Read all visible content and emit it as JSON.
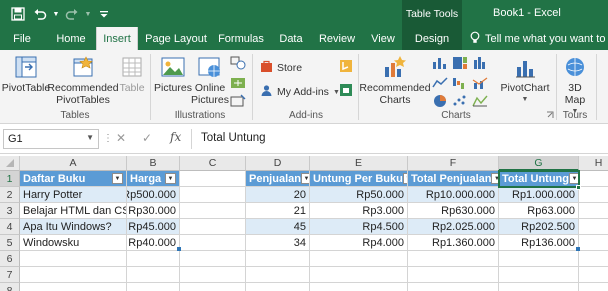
{
  "titlebar": {
    "table_tools": "Table Tools",
    "window_title": "Book1  -  Excel",
    "bg_color": "#217346"
  },
  "tabs": [
    {
      "label": "File"
    },
    {
      "label": "Home"
    },
    {
      "label": "Insert"
    },
    {
      "label": "Page Layout"
    },
    {
      "label": "Formulas"
    },
    {
      "label": "Data"
    },
    {
      "label": "Review"
    },
    {
      "label": "View"
    },
    {
      "label": "Design"
    }
  ],
  "tell_me": "Tell me what you want to do",
  "ribbon": {
    "pivottable": "PivotTable",
    "recommended_pivot_1": "Recommended",
    "recommended_pivot_2": "PivotTables",
    "table": "Table",
    "pictures": "Pictures",
    "online_pictures_1": "Online",
    "online_pictures_2": "Pictures",
    "store": "Store",
    "my_addins": "My Add-ins",
    "recommended_charts_1": "Recommended",
    "recommended_charts_2": "Charts",
    "pivotchart": "PivotChart",
    "map_1": "3D",
    "map_2": "Map",
    "groups": {
      "tables": "Tables",
      "illustrations": "Illustrations",
      "addins": "Add-ins",
      "charts": "Charts",
      "tours": "Tours"
    }
  },
  "formula_bar": {
    "name_box": "G1",
    "formula": "Total Untung"
  },
  "columns": [
    "A",
    "B",
    "C",
    "D",
    "E",
    "F",
    "G",
    "H"
  ],
  "rows": [
    "1",
    "2",
    "3",
    "4",
    "5",
    "6",
    "7",
    "8"
  ],
  "table1": {
    "headers": [
      "Daftar Buku",
      "Harga"
    ],
    "rows": [
      [
        "Harry Potter",
        "Rp500.000"
      ],
      [
        "Belajar HTML dan CSS",
        "Rp30.000"
      ],
      [
        "Apa Itu Windows?",
        "Rp45.000"
      ],
      [
        "Windowsku",
        "Rp40.000"
      ]
    ]
  },
  "table2": {
    "headers": [
      "Penjualan",
      "Untung Per Buku",
      "Total Penjualan",
      "Total Untung"
    ],
    "rows": [
      [
        "20",
        "Rp50.000",
        "Rp10.000.000",
        "Rp1.000.000"
      ],
      [
        "21",
        "Rp3.000",
        "Rp630.000",
        "Rp63.000"
      ],
      [
        "45",
        "Rp4.500",
        "Rp2.025.000",
        "Rp202.500"
      ],
      [
        "34",
        "Rp4.000",
        "Rp1.360.000",
        "Rp136.000"
      ]
    ]
  },
  "colors": {
    "excel_green": "#217346",
    "table_header": "#5b9bd5",
    "table_band": "#ddebf7"
  }
}
